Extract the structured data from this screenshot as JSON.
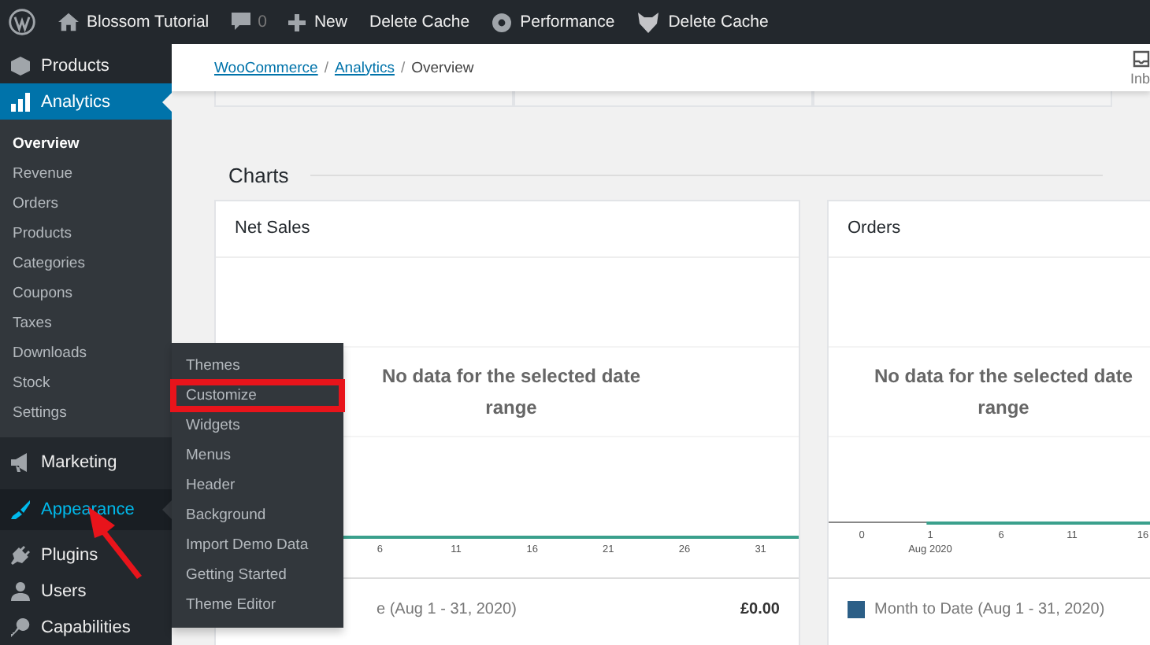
{
  "admin_bar": {
    "items": [
      {
        "kind": "logo"
      },
      {
        "kind": "site",
        "label": "Blossom Tutorial"
      },
      {
        "kind": "comments",
        "label": "0"
      },
      {
        "kind": "new",
        "label": "New"
      },
      {
        "kind": "plain",
        "label": "Delete Cache"
      },
      {
        "kind": "performance",
        "label": "Performance"
      },
      {
        "kind": "cache",
        "label": "Delete Cache"
      }
    ]
  },
  "sidebar": {
    "items": [
      {
        "kind": "box",
        "label": "Products",
        "selected": false,
        "hovered": false
      },
      {
        "kind": "bars",
        "label": "Analytics",
        "selected": true,
        "hovered": false,
        "children": [
          {
            "label": "Overview",
            "selected": true
          },
          {
            "label": "Revenue",
            "selected": false
          },
          {
            "label": "Orders",
            "selected": false
          },
          {
            "label": "Products",
            "selected": false
          },
          {
            "label": "Categories",
            "selected": false
          },
          {
            "label": "Coupons",
            "selected": false
          },
          {
            "label": "Taxes",
            "selected": false
          },
          {
            "label": "Downloads",
            "selected": false
          },
          {
            "label": "Stock",
            "selected": false
          },
          {
            "label": "Settings",
            "selected": false
          }
        ]
      },
      {
        "kind": "megaphone",
        "label": "Marketing",
        "selected": false,
        "hovered": false
      },
      {
        "kind": "brush",
        "label": "Appearance",
        "selected": false,
        "hovered": true
      },
      {
        "kind": "plug",
        "label": "Plugins",
        "selected": false,
        "hovered": false
      },
      {
        "kind": "user",
        "label": "Users",
        "selected": false,
        "hovered": false
      },
      {
        "kind": "key",
        "label": "Capabilities",
        "selected": false,
        "hovered": false
      }
    ]
  },
  "flyout_menu": {
    "items": [
      {
        "label": "Themes",
        "highlighted": false
      },
      {
        "label": "Customize",
        "highlighted": true
      },
      {
        "label": "Widgets",
        "highlighted": false
      },
      {
        "label": "Menus",
        "highlighted": false
      },
      {
        "label": "Header",
        "highlighted": false
      },
      {
        "label": "Background",
        "highlighted": false
      },
      {
        "label": "Import Demo Data",
        "highlighted": false
      },
      {
        "label": "Getting Started",
        "highlighted": false
      },
      {
        "label": "Theme Editor",
        "highlighted": false
      }
    ]
  },
  "header": {
    "breadcrumb_separator": "/",
    "breadcrumb": [
      {
        "label": "WooCommerce",
        "link": true
      },
      {
        "label": "Analytics",
        "link": true
      },
      {
        "label": "Overview",
        "link": false
      }
    ],
    "inbox": {
      "label": "Inb"
    }
  },
  "section_title": "Charts",
  "charts": [
    {
      "title": "Net Sales",
      "message": "No data for the selected date range",
      "ticks": [
        {
          "label": "6"
        },
        {
          "label": "11"
        },
        {
          "label": "16"
        },
        {
          "label": "21"
        },
        {
          "label": "26"
        },
        {
          "label": "31"
        }
      ],
      "legend": {
        "swatch": false,
        "label": "e (Aug 1 - 31, 2020)",
        "value": "£0.00"
      }
    },
    {
      "title": "Orders",
      "message": "No data for the selected date range",
      "ticks": [
        {
          "label": "0"
        },
        {
          "label": "1",
          "sublabel": "Aug 2020"
        },
        {
          "label": "6"
        },
        {
          "label": "11"
        },
        {
          "label": "16"
        }
      ],
      "legend": {
        "swatch": true,
        "label": "Month to Date (Aug 1 - 31, 2020)"
      }
    }
  ]
}
